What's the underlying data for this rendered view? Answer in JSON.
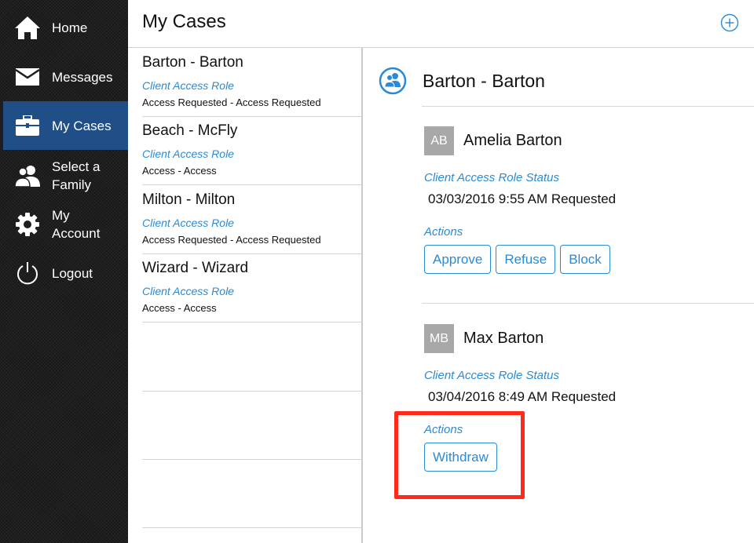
{
  "sidebar": {
    "items": [
      {
        "label": "Home",
        "icon": "home-icon",
        "active": false
      },
      {
        "label": "Messages",
        "icon": "envelope-icon",
        "active": false
      },
      {
        "label": "My Cases",
        "icon": "briefcase-icon",
        "active": true
      },
      {
        "label": "Select a\nFamily",
        "icon": "people-icon",
        "active": false
      },
      {
        "label": "My\nAccount",
        "icon": "gear-icon",
        "active": false
      },
      {
        "label": "Logout",
        "icon": "power-icon",
        "active": false
      }
    ],
    "active_color": "#1f4f86"
  },
  "header": {
    "title": "My Cases",
    "add_icon": "plus-circle-icon"
  },
  "case_list": [
    {
      "name": "Barton - Barton",
      "role": "Client Access Role",
      "status": "Access Requested - Access Requested"
    },
    {
      "name": "Beach - McFly",
      "role": "Client Access Role",
      "status": "Access - Access"
    },
    {
      "name": "Milton - Milton",
      "role": "Client Access Role",
      "status": "Access Requested - Access Requested"
    },
    {
      "name": "Wizard - Wizard",
      "role": "Client Access Role",
      "status": "Access - Access"
    }
  ],
  "detail": {
    "title": "Barton - Barton",
    "icon": "family-circle-icon",
    "members": [
      {
        "initials": "AB",
        "name": "Amelia Barton",
        "status_label": "Client Access Role Status",
        "status_value": "03/03/2016 9:55 AM Requested",
        "actions_label": "Actions",
        "actions": [
          "Approve",
          "Refuse",
          "Block"
        ]
      },
      {
        "initials": "MB",
        "name": "Max Barton",
        "status_label": "Client Access Role Status",
        "status_value": "03/04/2016 8:49 AM Requested",
        "actions_label": "Actions",
        "actions": [
          "Withdraw"
        ]
      }
    ]
  },
  "colors": {
    "accent": "#2a8ad4",
    "highlight": "#ff2a1a"
  }
}
